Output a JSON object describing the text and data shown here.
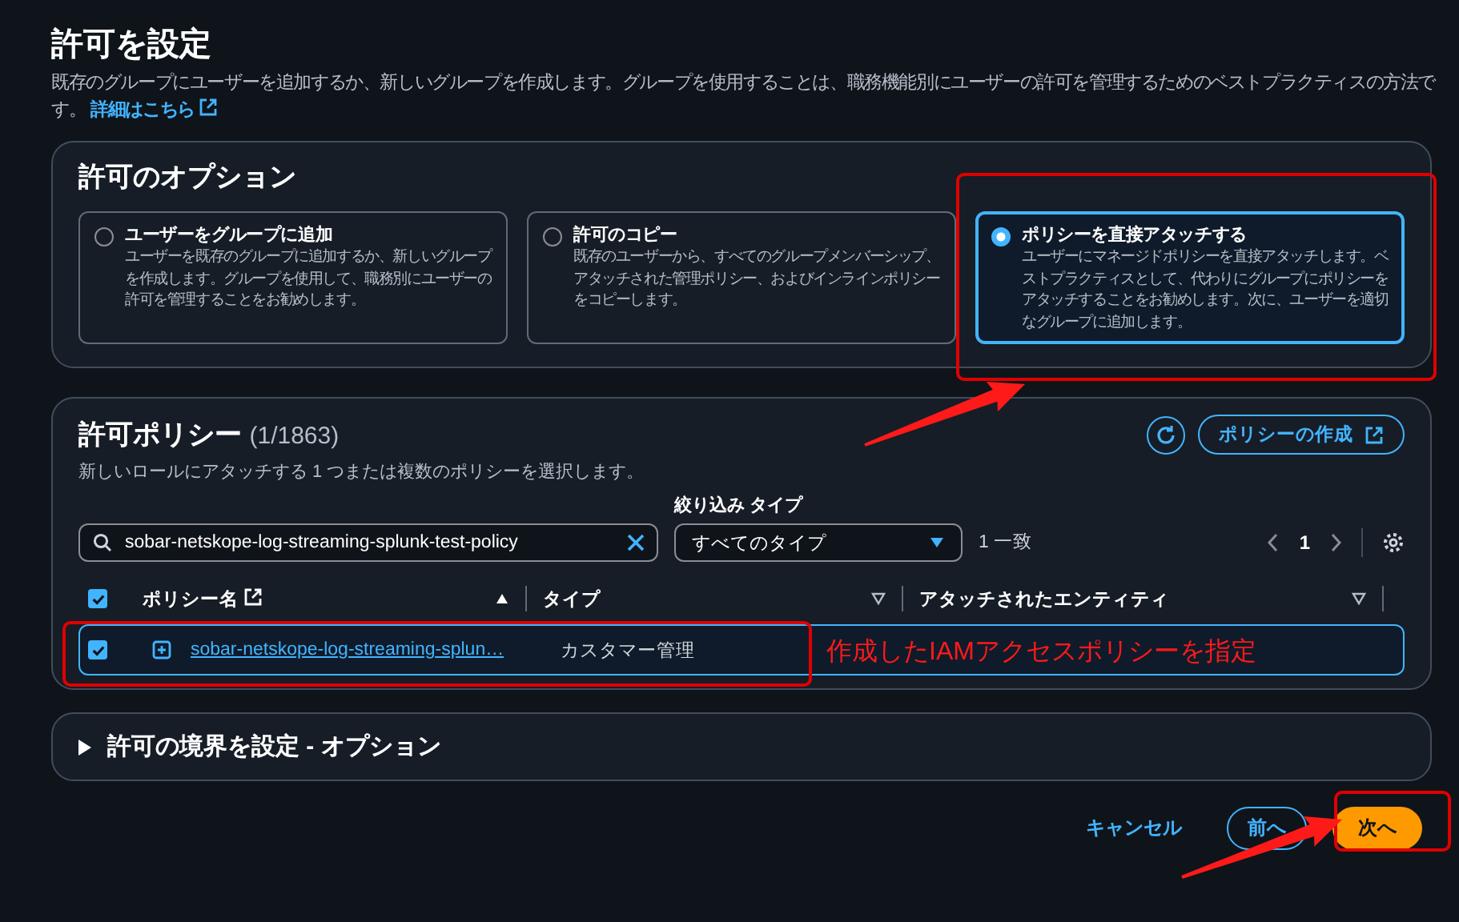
{
  "header": {
    "title": "許可を設定",
    "description": "既存のグループにユーザーを追加するか、新しいグループを作成します。グループを使用することは、職務機能別にユーザーの許可を管理するためのベストプラクティスの方法です。",
    "learn_more": "詳細はこちら"
  },
  "options": {
    "title": "許可のオプション",
    "items": [
      {
        "label": "ユーザーをグループに追加",
        "description": "ユーザーを既存のグループに追加するか、新しいグループを作成します。グループを使用して、職務別にユーザーの許可を管理することをお勧めします。",
        "selected": false
      },
      {
        "label": "許可のコピー",
        "description": "既存のユーザーから、すべてのグループメンバーシップ、アタッチされた管理ポリシー、およびインラインポリシーをコピーします。",
        "selected": false
      },
      {
        "label": "ポリシーを直接アタッチする",
        "description": "ユーザーにマネージドポリシーを直接アタッチします。ベストプラクティスとして、代わりにグループにポリシーをアタッチすることをお勧めします。次に、ユーザーを適切なグループに追加します。",
        "selected": true
      }
    ]
  },
  "policies": {
    "title": "許可ポリシー",
    "count": "(1/1863)",
    "description": "新しいロールにアタッチする 1 つまたは複数のポリシーを選択します。",
    "create_button": "ポリシーの作成",
    "search": {
      "value": "sobar-netskope-log-streaming-splunk-test-policy"
    },
    "filter": {
      "label": "絞り込み タイプ",
      "value": "すべてのタイプ"
    },
    "match_count": "1 一致",
    "page": "1",
    "select_all_checked": true,
    "columns": [
      {
        "label": "ポリシー名",
        "sorted": true
      },
      {
        "label": "タイプ",
        "sorted": false
      },
      {
        "label": "アタッチされたエンティティ",
        "sorted": false
      }
    ],
    "rows": [
      {
        "name": "sobar-netskope-log-streaming-splun…",
        "type": "カスタマー管理",
        "selected": true
      }
    ]
  },
  "boundary": {
    "title": "許可の境界を設定 - オプション",
    "expanded": false
  },
  "footer": {
    "cancel": "キャンセル",
    "previous": "前へ",
    "next": "次へ"
  },
  "annotations": [
    {
      "kind": "box"
    },
    {
      "kind": "box"
    },
    {
      "kind": "box"
    },
    {
      "kind": "arrow"
    },
    {
      "kind": "arrow"
    },
    {
      "kind": "label",
      "text": "作成したIAMアクセスポリシーを指定"
    }
  ]
}
